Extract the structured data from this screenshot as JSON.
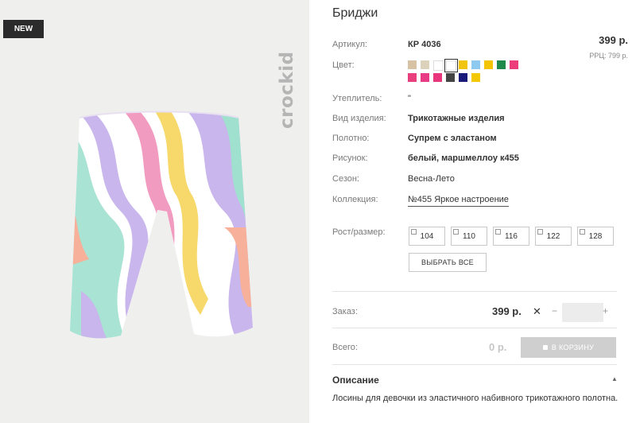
{
  "photo": {
    "badge": "NEW",
    "brand": "crockid"
  },
  "product": {
    "title": "Бриджи",
    "article_label": "Артикул:",
    "article": "КР 4036",
    "price": "399 р.",
    "rrp": "РРЦ: 799 р.",
    "color_label": "Цвет:",
    "swatches": [
      {
        "color": "#d7c3a3"
      },
      {
        "color": "#dcd2bc"
      },
      {
        "color": "#ffffff"
      },
      {
        "color": "#ffffff",
        "selected": true
      },
      {
        "color": "#f1c40f"
      },
      {
        "color": "#8ecaf0"
      },
      {
        "color": "#f3c500"
      },
      {
        "color": "#1f8a4c"
      },
      {
        "color": "#ec3d7a"
      },
      {
        "color": "#ea3f7d"
      },
      {
        "color": "#e93a86"
      },
      {
        "color": "#e8357c"
      },
      {
        "color": "#444444"
      },
      {
        "color": "#1a1a7a"
      },
      {
        "color": "#f3c800"
      }
    ],
    "specs": [
      {
        "label": "Утеплитель:",
        "value": "\"",
        "bold": false
      },
      {
        "label": "Вид изделия:",
        "value": "Трикотажные изделия",
        "bold": true
      },
      {
        "label": "Полотно:",
        "value": "Супрем с эластаном",
        "bold": true
      },
      {
        "label": "Рисунок:",
        "value": "белый, маршмеллоу к455",
        "bold": true
      },
      {
        "label": "Сезон:",
        "value": "Весна-Лето",
        "bold": false
      },
      {
        "label": "Коллекция:",
        "value": "№455 Яркое настроение",
        "bold": false
      }
    ],
    "size_label": "Рост/размер:",
    "sizes": [
      "104",
      "110",
      "116",
      "122",
      "128"
    ],
    "select_all": "ВЫБРАТЬ ВСЕ",
    "order_label": "Заказ:",
    "order_price": "399 р.",
    "order_x": "✕",
    "qty_minus": "−",
    "qty_plus": "+",
    "total_label": "Всего:",
    "total_value": "0 р.",
    "cart_button": "В КОРЗИНУ",
    "desc_title": "Описание",
    "desc_arrow": "▲",
    "desc_text": "Лосины для девочки из эластичного набивного трикотажного полотна."
  }
}
